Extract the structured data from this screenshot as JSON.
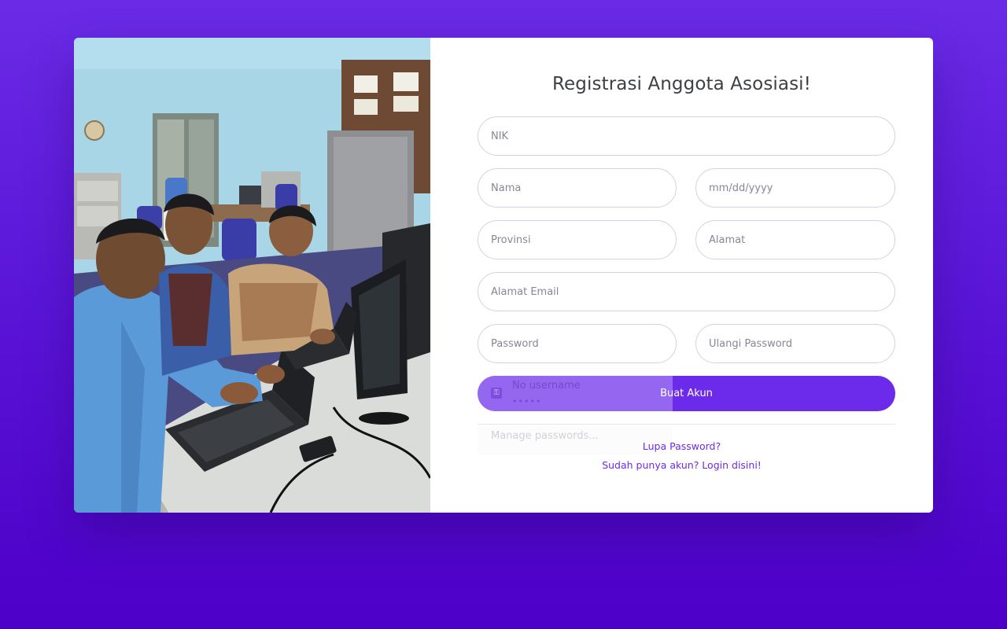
{
  "form": {
    "title": "Registrasi Anggota Asosiasi!",
    "fields": {
      "nik": "NIK",
      "nama": "Nama",
      "tanggal_lahir": "mm/dd/yyyy",
      "provinsi": "Provinsi",
      "alamat": "Alamat",
      "email": "Alamat Email",
      "password": "Password",
      "ulangi_password": "Ulangi Password"
    },
    "submit_label": "Buat Akun",
    "forgot_link": "Lupa Password?",
    "login_link": "Sudah punya akun? Login disini!"
  },
  "autofill": {
    "username": "No username",
    "password_dots": "•••••",
    "manage": "Manage passwords..."
  },
  "colors": {
    "primary": "#6c2bea",
    "background_top": "#6a2be6",
    "background_bottom": "#4d00c8"
  }
}
